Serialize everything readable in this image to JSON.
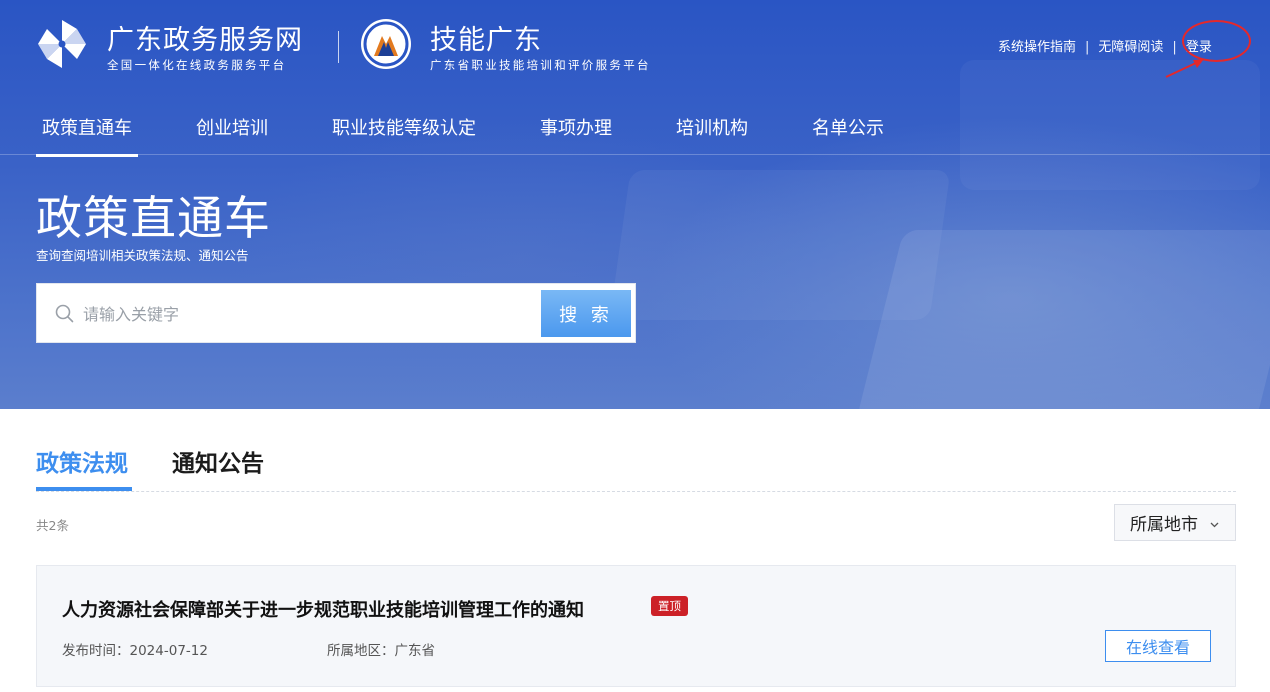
{
  "header": {
    "brand_title": "广东政务服务网",
    "brand_sub": "全国一体化在线政务服务平台",
    "skill_title": "技能广东",
    "skill_sub": "广东省职业技能培训和评价服务平台",
    "links": {
      "guide": "系统操作指南",
      "accessible": "无障碍阅读",
      "login": "登录",
      "separator": "|"
    }
  },
  "nav": {
    "items": [
      {
        "label": "政策直通车"
      },
      {
        "label": "创业培训"
      },
      {
        "label": "职业技能等级认定"
      },
      {
        "label": "事项办理"
      },
      {
        "label": "培训机构"
      },
      {
        "label": "名单公示"
      }
    ]
  },
  "hero": {
    "title": "政策直通车",
    "subtitle": "查询查阅培训相关政策法规、通知公告"
  },
  "search": {
    "placeholder": "请输入关键字",
    "value": "",
    "button": "搜 索"
  },
  "tabs": [
    {
      "label": "政策法规"
    },
    {
      "label": "通知公告"
    }
  ],
  "list": {
    "total": "共2条",
    "region_filter": "所属地市",
    "items": [
      {
        "title": "人力资源社会保障部关于进一步规范职业技能培训管理工作的通知",
        "badge": "置顶",
        "publish_label": "发布时间：",
        "publish_date": "2024-07-12",
        "region_label": "所属地区：",
        "region": "广东省",
        "action": "在线查看"
      }
    ]
  },
  "colors": {
    "header_blue": "#2a55c4",
    "accent_blue": "#3d8eef",
    "badge_red": "#cc2127",
    "annotation_red": "#e5282b"
  },
  "icons": [
    "pinwheel-logo-icon",
    "emblem-icon",
    "search-icon",
    "chevron-down-icon",
    "annotation-arrow-icon"
  ]
}
